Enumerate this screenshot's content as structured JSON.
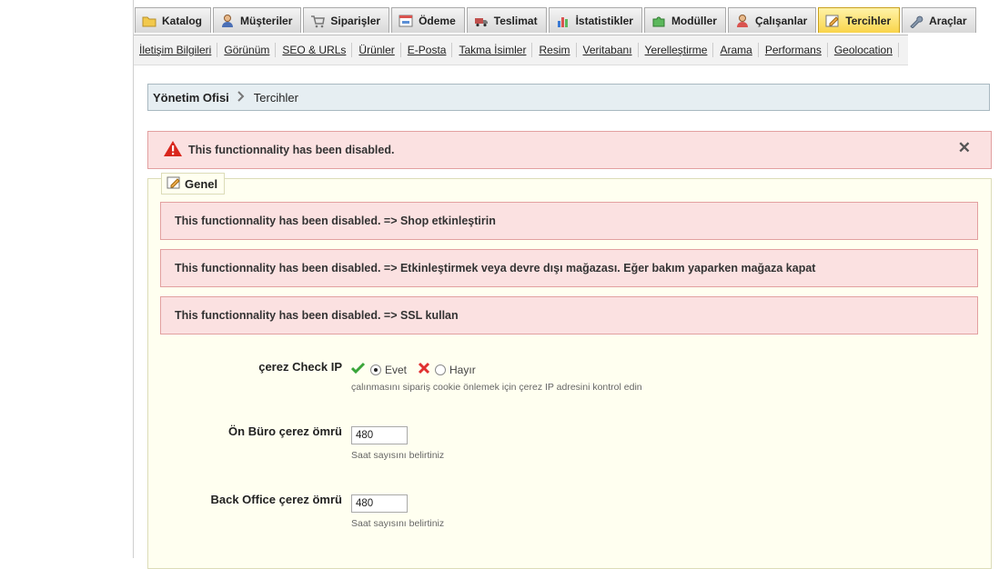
{
  "tabs": [
    {
      "label": "Katalog",
      "icon": "folder-icon",
      "active": false
    },
    {
      "label": "Müşteriler",
      "icon": "customer-icon",
      "active": false
    },
    {
      "label": "Siparişler",
      "icon": "cart-icon",
      "active": false
    },
    {
      "label": "Ödeme",
      "icon": "payment-icon",
      "active": false
    },
    {
      "label": "Teslimat",
      "icon": "truck-icon",
      "active": false
    },
    {
      "label": "İstatistikler",
      "icon": "stats-icon",
      "active": false
    },
    {
      "label": "Modüller",
      "icon": "puzzle-icon",
      "active": false
    },
    {
      "label": "Çalışanlar",
      "icon": "employee-icon",
      "active": false
    },
    {
      "label": "Tercihler",
      "icon": "preferences-icon",
      "active": true
    },
    {
      "label": "Araçlar",
      "icon": "wrench-icon",
      "active": false
    }
  ],
  "subnav": [
    "İletişim Bilgileri",
    "Görünüm",
    "SEO & URLs",
    "Ürünler",
    "E-Posta",
    "Takma İsimler",
    "Resim",
    "Veritabanı",
    "Yerelleştirme",
    "Arama",
    "Performans",
    "Geolocation"
  ],
  "breadcrumb": {
    "home": "Yönetim Ofisi",
    "separator": ">",
    "current": "Tercihler"
  },
  "top_alert": {
    "message": "This functionnality has been disabled.",
    "close": "✕"
  },
  "fieldset": {
    "legend": "Genel",
    "alerts": [
      "This functionnality has been disabled. => Shop etkinleştirin",
      "This functionnality has been disabled. => Etkinleştirmek veya devre dışı mağazası. Eğer bakım yaparken mağaza kapat",
      "This functionnality has been disabled. => SSL kullan"
    ],
    "cookie_check_ip": {
      "label": "çerez Check IP",
      "yes": "Evet",
      "no": "Hayır",
      "selected": "Evet",
      "hint": "çalınmasını sipariş cookie önlemek için çerez IP adresini kontrol edin"
    },
    "front_cookie": {
      "label": "Ön Büro çerez ömrü",
      "value": "480",
      "hint": "Saat sayısını belirtiniz"
    },
    "back_cookie": {
      "label": "Back Office çerez ömrü",
      "value": "480",
      "hint": "Saat sayısını belirtiniz"
    }
  },
  "colors": {
    "active_tab": "#f9d44a",
    "alert_bg": "#fbe1e1",
    "fieldset_bg": "#fffff0",
    "breadcrumb_bg": "#e6eef2"
  }
}
